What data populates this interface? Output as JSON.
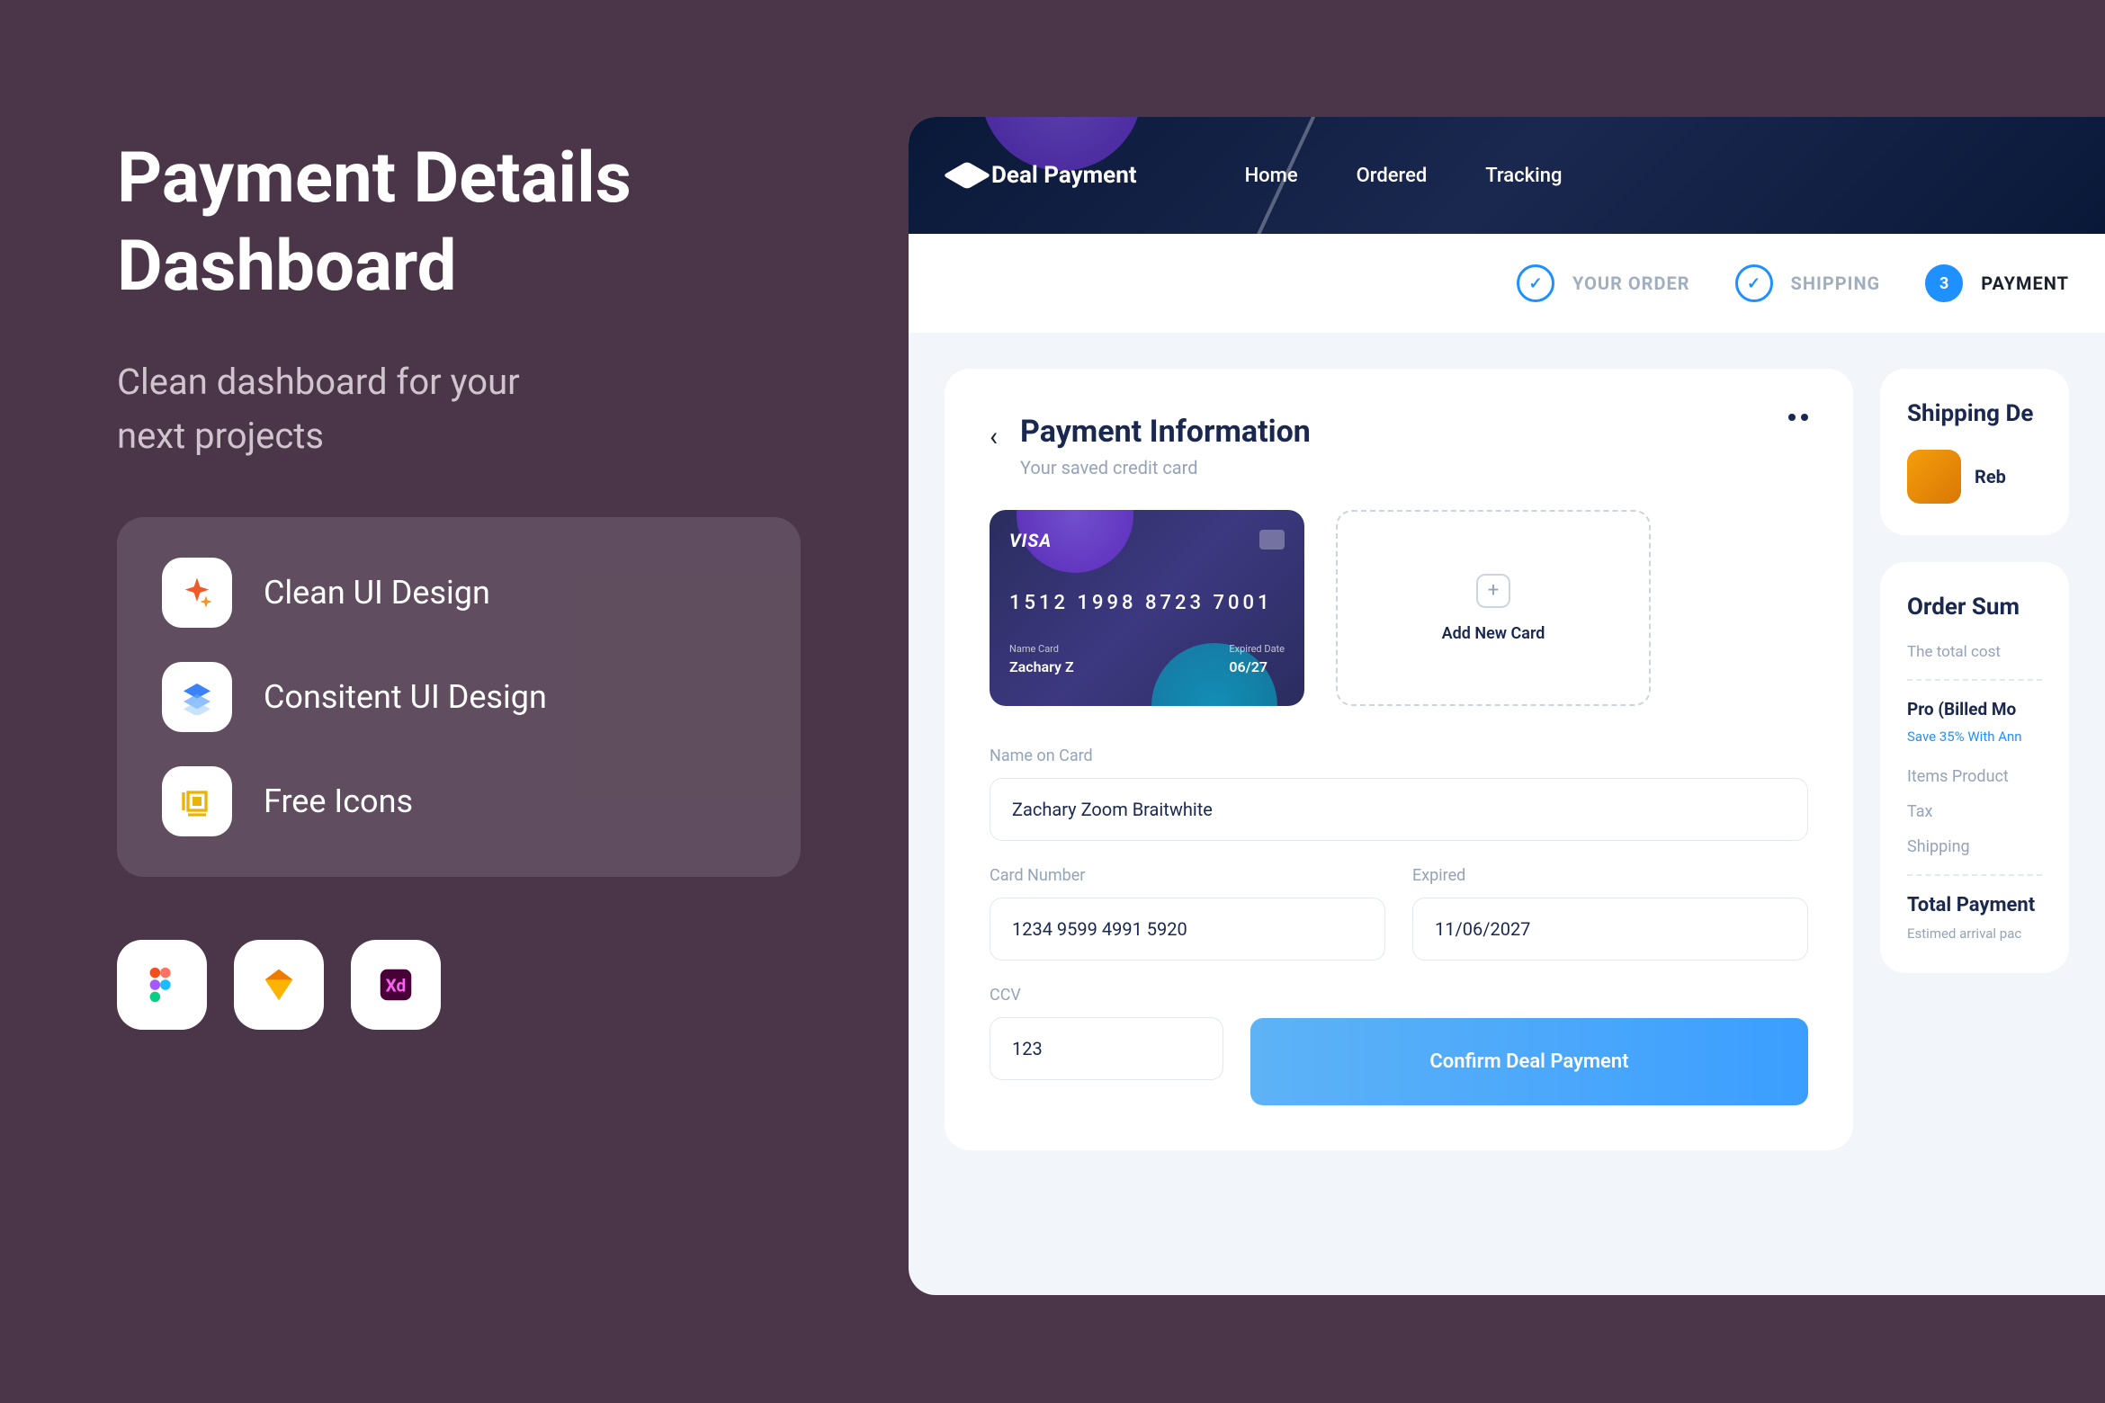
{
  "promo": {
    "title_line1": "Payment Details",
    "title_line2": "Dashboard",
    "subtitle_line1": "Clean dashboard for your",
    "subtitle_line2": "next projects",
    "features": [
      {
        "label": "Clean UI Design",
        "icon": "sparkle"
      },
      {
        "label": "Consitent UI Design",
        "icon": "layers"
      },
      {
        "label": "Free Icons",
        "icon": "frame"
      }
    ],
    "tools": [
      "figma",
      "sketch",
      "xd"
    ]
  },
  "dashboard": {
    "logo": "Deal Payment",
    "nav": [
      "Home",
      "Ordered",
      "Tracking"
    ],
    "steps": [
      {
        "label": "YOUR ORDER",
        "state": "done"
      },
      {
        "label": "SHIPPING",
        "state": "done"
      },
      {
        "label": "PAYMENT",
        "state": "active",
        "num": "3"
      }
    ],
    "payment": {
      "title": "Payment Information",
      "subtitle": "Your saved credit card",
      "card": {
        "brand": "VISA",
        "number": "1512  1998  8723  7001",
        "name_label": "Name Card",
        "name": "Zachary Z",
        "exp_label": "Expired Date",
        "exp": "06/27"
      },
      "add_card": "Add New Card",
      "form": {
        "name_label": "Name on Card",
        "name_value": "Zachary Zoom Braitwhite",
        "number_label": "Card Number",
        "number_value": "1234 9599 4991 5920",
        "exp_label": "Expired",
        "exp_value": "11/06/2027",
        "ccv_label": "CCV",
        "ccv_value": "123",
        "confirm": "Confirm Deal Payment"
      }
    },
    "shipping": {
      "title": "Shipping De",
      "name": "Reb"
    },
    "summary": {
      "title": "Order Sum",
      "subtitle": "The total cost",
      "plan": "Pro (Billed Mo",
      "discount": "Save 35% With Ann",
      "rows": [
        "Items Product",
        "Tax",
        "Shipping"
      ],
      "total_label": "Total Payment",
      "note": "Estimed arrival pac"
    }
  }
}
